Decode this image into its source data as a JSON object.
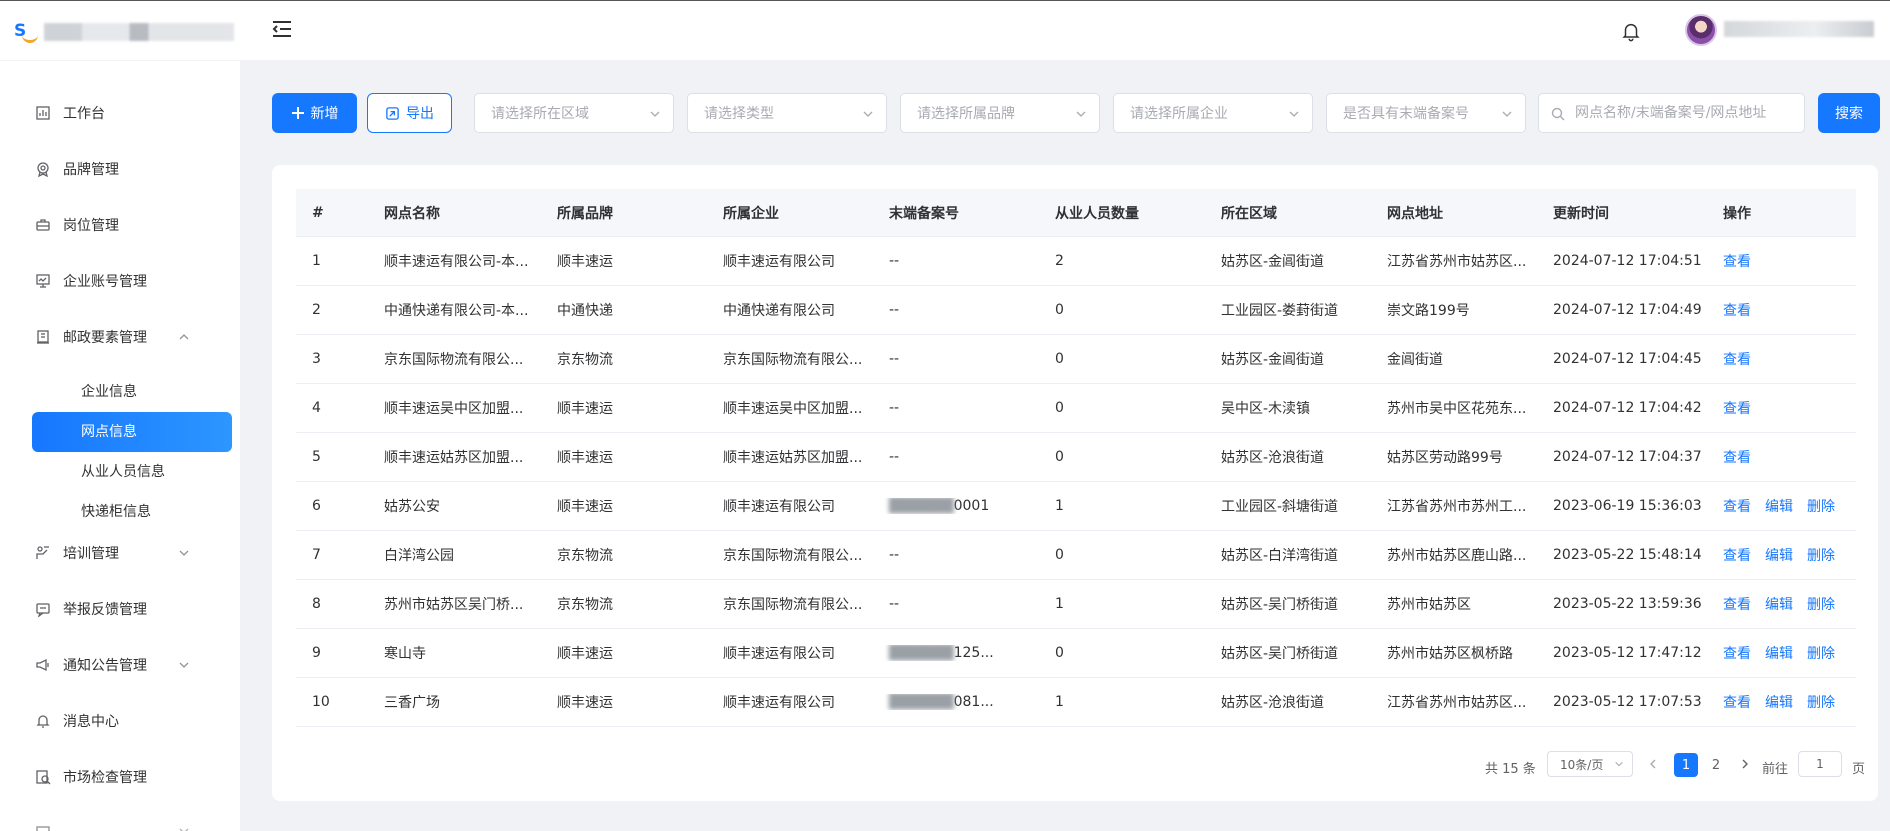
{
  "header": {
    "logo_letter": "S",
    "menu_icon": "menu-fold-icon",
    "bell_icon": "bell-icon"
  },
  "sidebar": {
    "items": [
      {
        "label": "工作台",
        "icon": "dashboard-icon"
      },
      {
        "label": "品牌管理",
        "icon": "brand-icon"
      },
      {
        "label": "岗位管理",
        "icon": "briefcase-icon"
      },
      {
        "label": "企业账号管理",
        "icon": "monitor-icon"
      },
      {
        "label": "邮政要素管理",
        "icon": "building-icon",
        "expanded": true
      },
      {
        "label": "培训管理",
        "icon": "training-icon"
      },
      {
        "label": "举报反馈管理",
        "icon": "feedback-icon"
      },
      {
        "label": "通知公告管理",
        "icon": "announcement-icon"
      },
      {
        "label": "消息中心",
        "icon": "bell-icon"
      },
      {
        "label": "市场检查管理",
        "icon": "inspection-icon"
      }
    ],
    "sub_items": [
      {
        "label": "企业信息"
      },
      {
        "label": "网点信息",
        "active": true
      },
      {
        "label": "从业人员信息"
      },
      {
        "label": "快递柜信息"
      }
    ]
  },
  "toolbar": {
    "add_label": "新增",
    "export_label": "导出",
    "region_placeholder": "请选择所在区域",
    "type_placeholder": "请选择类型",
    "brand_placeholder": "请选择所属品牌",
    "company_placeholder": "请选择所属企业",
    "record_placeholder": "是否具有末端备案号",
    "search_placeholder": "网点名称/末端备案号/网点地址",
    "search_value": "",
    "search_label": "搜索"
  },
  "table": {
    "columns": [
      "#",
      "网点名称",
      "所属品牌",
      "所属企业",
      "末端备案号",
      "从业人员数量",
      "所在区域",
      "网点地址",
      "更新时间",
      "操作"
    ],
    "rows": [
      {
        "idx": "1",
        "name": "顺丰速运有限公司-本...",
        "brand": "顺丰速运",
        "company": "顺丰速运有限公司",
        "record": "--",
        "staff": "2",
        "region": "姑苏区-金阊街道",
        "address": "江苏省苏州市姑苏区...",
        "time": "2024-07-12 17:04:51",
        "ops": [
          "查看"
        ]
      },
      {
        "idx": "2",
        "name": "中通快递有限公司-本...",
        "brand": "中通快递",
        "company": "中通快递有限公司",
        "record": "--",
        "staff": "0",
        "region": "工业园区-娄葑街道",
        "address": "崇文路199号",
        "time": "2024-07-12 17:04:49",
        "ops": [
          "查看"
        ]
      },
      {
        "idx": "3",
        "name": "京东国际物流有限公...",
        "brand": "京东物流",
        "company": "京东国际物流有限公...",
        "record": "--",
        "staff": "0",
        "region": "姑苏区-金阊街道",
        "address": "金阊街道",
        "time": "2024-07-12 17:04:45",
        "ops": [
          "查看"
        ]
      },
      {
        "idx": "4",
        "name": "顺丰速运吴中区加盟...",
        "brand": "顺丰速运",
        "company": "顺丰速运吴中区加盟...",
        "record": "--",
        "staff": "0",
        "region": "吴中区-木渎镇",
        "address": "苏州市吴中区花苑东...",
        "time": "2024-07-12 17:04:42",
        "ops": [
          "查看"
        ]
      },
      {
        "idx": "5",
        "name": "顺丰速运姑苏区加盟...",
        "brand": "顺丰速运",
        "company": "顺丰速运姑苏区加盟...",
        "record": "--",
        "staff": "0",
        "region": "姑苏区-沧浪街道",
        "address": "姑苏区劳动路99号",
        "time": "2024-07-12 17:04:37",
        "ops": [
          "查看"
        ]
      },
      {
        "idx": "6",
        "name": "姑苏公安",
        "brand": "顺丰速运",
        "company": "顺丰速运有限公司",
        "record": "0001",
        "staff": "1",
        "region": "工业园区-斜塘街道",
        "address": "江苏省苏州市苏州工...",
        "time": "2023-06-19 15:36:03",
        "ops": [
          "查看",
          "编辑",
          "删除"
        ]
      },
      {
        "idx": "7",
        "name": "白洋湾公园",
        "brand": "京东物流",
        "company": "京东国际物流有限公...",
        "record": "--",
        "staff": "0",
        "region": "姑苏区-白洋湾街道",
        "address": "苏州市姑苏区鹿山路...",
        "time": "2023-05-22 15:48:14",
        "ops": [
          "查看",
          "编辑",
          "删除"
        ]
      },
      {
        "idx": "8",
        "name": "苏州市姑苏区吴门桥...",
        "brand": "京东物流",
        "company": "京东国际物流有限公...",
        "record": "--",
        "staff": "1",
        "region": "姑苏区-吴门桥街道",
        "address": "苏州市姑苏区",
        "time": "2023-05-22 13:59:36",
        "ops": [
          "查看",
          "编辑",
          "删除"
        ]
      },
      {
        "idx": "9",
        "name": "寒山寺",
        "brand": "顺丰速运",
        "company": "顺丰速运有限公司",
        "record": "125...",
        "staff": "0",
        "region": "姑苏区-吴门桥街道",
        "address": "苏州市姑苏区枫桥路",
        "time": "2023-05-12 17:47:12",
        "ops": [
          "查看",
          "编辑",
          "删除"
        ]
      },
      {
        "idx": "10",
        "name": "三香广场",
        "brand": "顺丰速运",
        "company": "顺丰速运有限公司",
        "record": "081...",
        "staff": "1",
        "region": "姑苏区-沧浪街道",
        "address": "江苏省苏州市姑苏区...",
        "time": "2023-05-12 17:07:53",
        "ops": [
          "查看",
          "编辑",
          "删除"
        ]
      }
    ]
  },
  "pagination": {
    "total_text": "共 15 条",
    "page_size": "10条/页",
    "pages": [
      "1",
      "2"
    ],
    "current": "1",
    "goto_label": "前往",
    "goto_value": "1",
    "page_unit": "页"
  },
  "colors": {
    "primary": "#1677ff",
    "background": "#f0f2f5",
    "header_bg": "#f5f7fa"
  }
}
